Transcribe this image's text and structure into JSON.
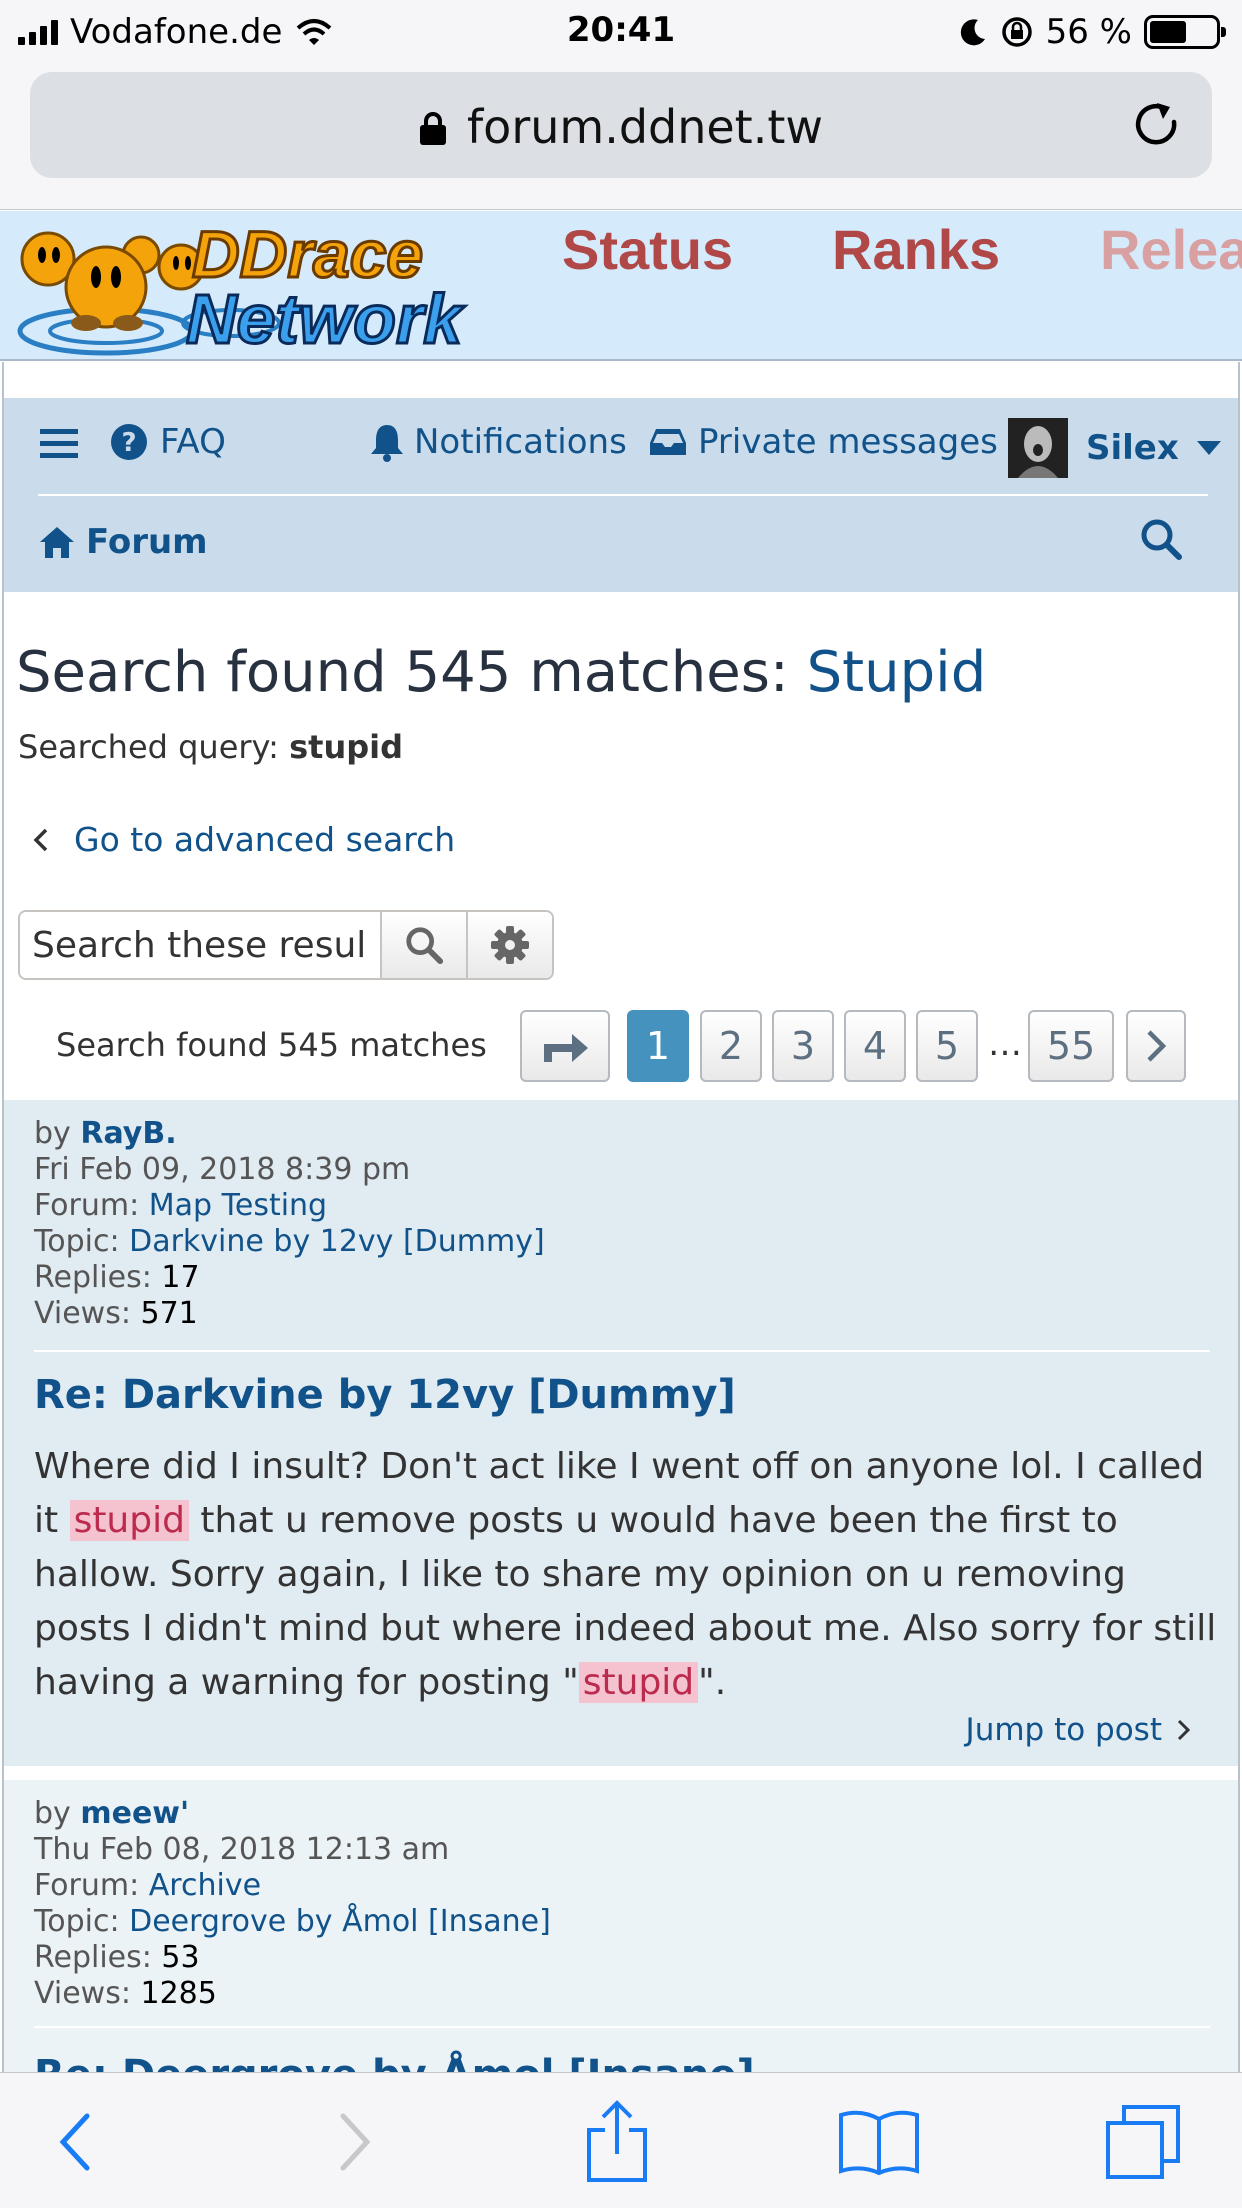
{
  "status_bar": {
    "carrier": "Vodafone.de",
    "time": "20:41",
    "battery": "56 %"
  },
  "browser": {
    "url": "forum.ddnet.tw"
  },
  "site": {
    "logo_line1": "DDrace",
    "logo_line2": "Network",
    "nav": [
      "Status",
      "Ranks",
      "Relea"
    ]
  },
  "navbar": {
    "faq": "FAQ",
    "notifications": "Notifications",
    "private_messages": "Private messages",
    "username": "Silex",
    "forum": "Forum"
  },
  "search": {
    "heading_prefix": "Search found 545 matches: ",
    "heading_keyword": "Stupid",
    "query_label": "Searched query: ",
    "query_value": "stupid",
    "advanced_link": "Go to advanced search",
    "box_placeholder": "Search these results",
    "box_value": "Search these resul"
  },
  "pagination": {
    "label": "Search found 545 matches",
    "pages": [
      "1",
      "2",
      "3",
      "4",
      "5"
    ],
    "ellipsis": "…",
    "last": "55",
    "active": "1"
  },
  "results": [
    {
      "by_label": "by",
      "author": "RayB.",
      "date": "Fri Feb 09, 2018 8:39 pm",
      "forum_label": "Forum:",
      "forum": "Map Testing",
      "topic_label": "Topic:",
      "topic": "Darkvine by 12vy [Dummy]",
      "replies_label": "Replies:",
      "replies": "17",
      "views_label": "Views:",
      "views": "571",
      "title": "Re: Darkvine by 12vy [Dummy]",
      "body_1": "Where did I insult? Don't act like I went off on anyone lol. I called it ",
      "body_hl1": "stupid",
      "body_2": " that u remove posts u would have been the first to hallow. Sorry again, I like to share my opinion on u removing posts I didn't mind but where indeed about me. Also sorry for still having a warning for posting \"",
      "body_hl2": "stupid",
      "body_3": "\".",
      "jump": "Jump to post"
    },
    {
      "by_label": "by",
      "author": "meew'",
      "date": "Thu Feb 08, 2018 12:13 am",
      "forum_label": "Forum:",
      "forum": "Archive",
      "topic_label": "Topic:",
      "topic": "Deergrove by Åmol [Insane]",
      "replies_label": "Replies:",
      "replies": "53",
      "views_label": "Views:",
      "views": "1285",
      "title": "Re: Deergrove by Åmol [Insane]"
    }
  ],
  "colors": {
    "link": "#105289",
    "banner_bg": "#d5ebfb",
    "navbar_bg": "#cadceb",
    "post_bg": "#e1ebf2",
    "highlight": "#f4c3cf",
    "active_page": "#4692bf",
    "site_nav": "#b04848"
  },
  "icons": [
    "signal-icon",
    "wifi-icon",
    "moon-icon",
    "rotation-lock-icon",
    "battery-icon",
    "lock-icon",
    "reload-icon",
    "hamburger-icon",
    "question-circle-icon",
    "bell-icon",
    "inbox-icon",
    "avatar",
    "caret-down-icon",
    "home-icon",
    "search-icon",
    "chevron-left-icon",
    "gear-icon",
    "jump-arrow-icon",
    "chevron-right-icon",
    "back-icon",
    "forward-icon",
    "share-icon",
    "bookmarks-icon",
    "tabs-icon"
  ]
}
